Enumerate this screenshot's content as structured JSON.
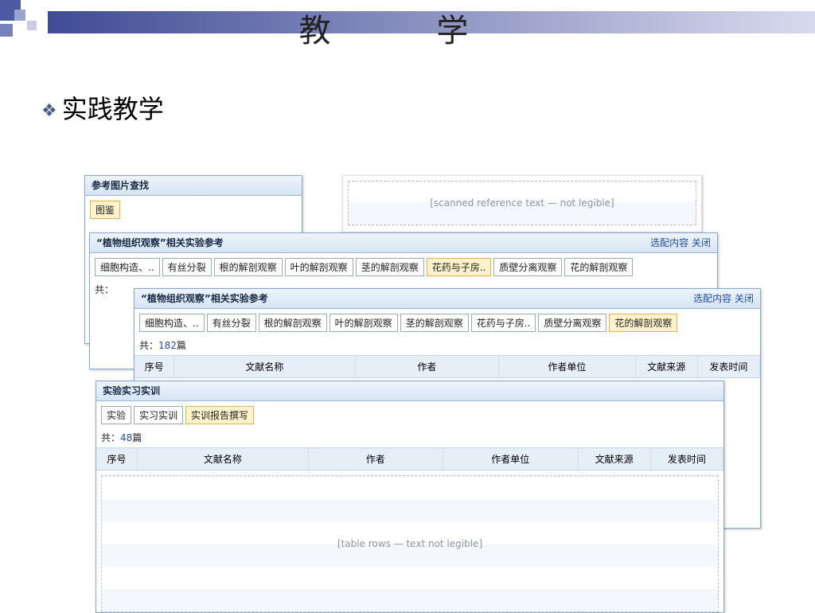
{
  "slide": {
    "title": "教 学",
    "bullet": "实践教学",
    "placeholder_note": "[table rows — text not legible]"
  },
  "panels": {
    "search": {
      "header": "参考图片查找",
      "tab": "图鉴"
    },
    "cnki_excerpt": {
      "placeholder": "[scanned reference text — not legible]"
    },
    "plant_back": {
      "header": "“植物组织观察”相关实验参考",
      "actions": "选配内容 关闭",
      "tabs": [
        "细胞构造、..",
        "有丝分裂",
        "根的解剖观察",
        "叶的解剖观察",
        "茎的解剖观察",
        "花药与子房..",
        "质壁分离观察",
        "花的解剖观察"
      ],
      "count_label": "共："
    },
    "plant_front": {
      "header": "“植物组织观察”相关实验参考",
      "actions": "选配内容 关闭",
      "tabs": [
        "细胞构造、..",
        "有丝分裂",
        "根的解剖观察",
        "叶的解剖观察",
        "茎的解剖观察",
        "花药与子房..",
        "质壁分离观察",
        "花的解剖观察"
      ],
      "count_label": "共：",
      "count_value": "182",
      "count_unit": "篇",
      "columns": [
        "序号",
        "文献名称",
        "作者",
        "作者单位",
        "文献来源",
        "发表时间"
      ]
    },
    "training": {
      "header": "实验实习实训",
      "tabs": [
        "实验",
        "实习实训",
        "实训报告撰写"
      ],
      "count_label": "共：",
      "count_value": "48",
      "count_unit": "篇",
      "columns": [
        "序号",
        "文献名称",
        "作者",
        "作者单位",
        "文献来源",
        "发表时间"
      ]
    }
  },
  "colors": {
    "accent": "#1f4fa8",
    "active_tab": "#fff3cc",
    "header_blue": "#d6e4f3"
  }
}
